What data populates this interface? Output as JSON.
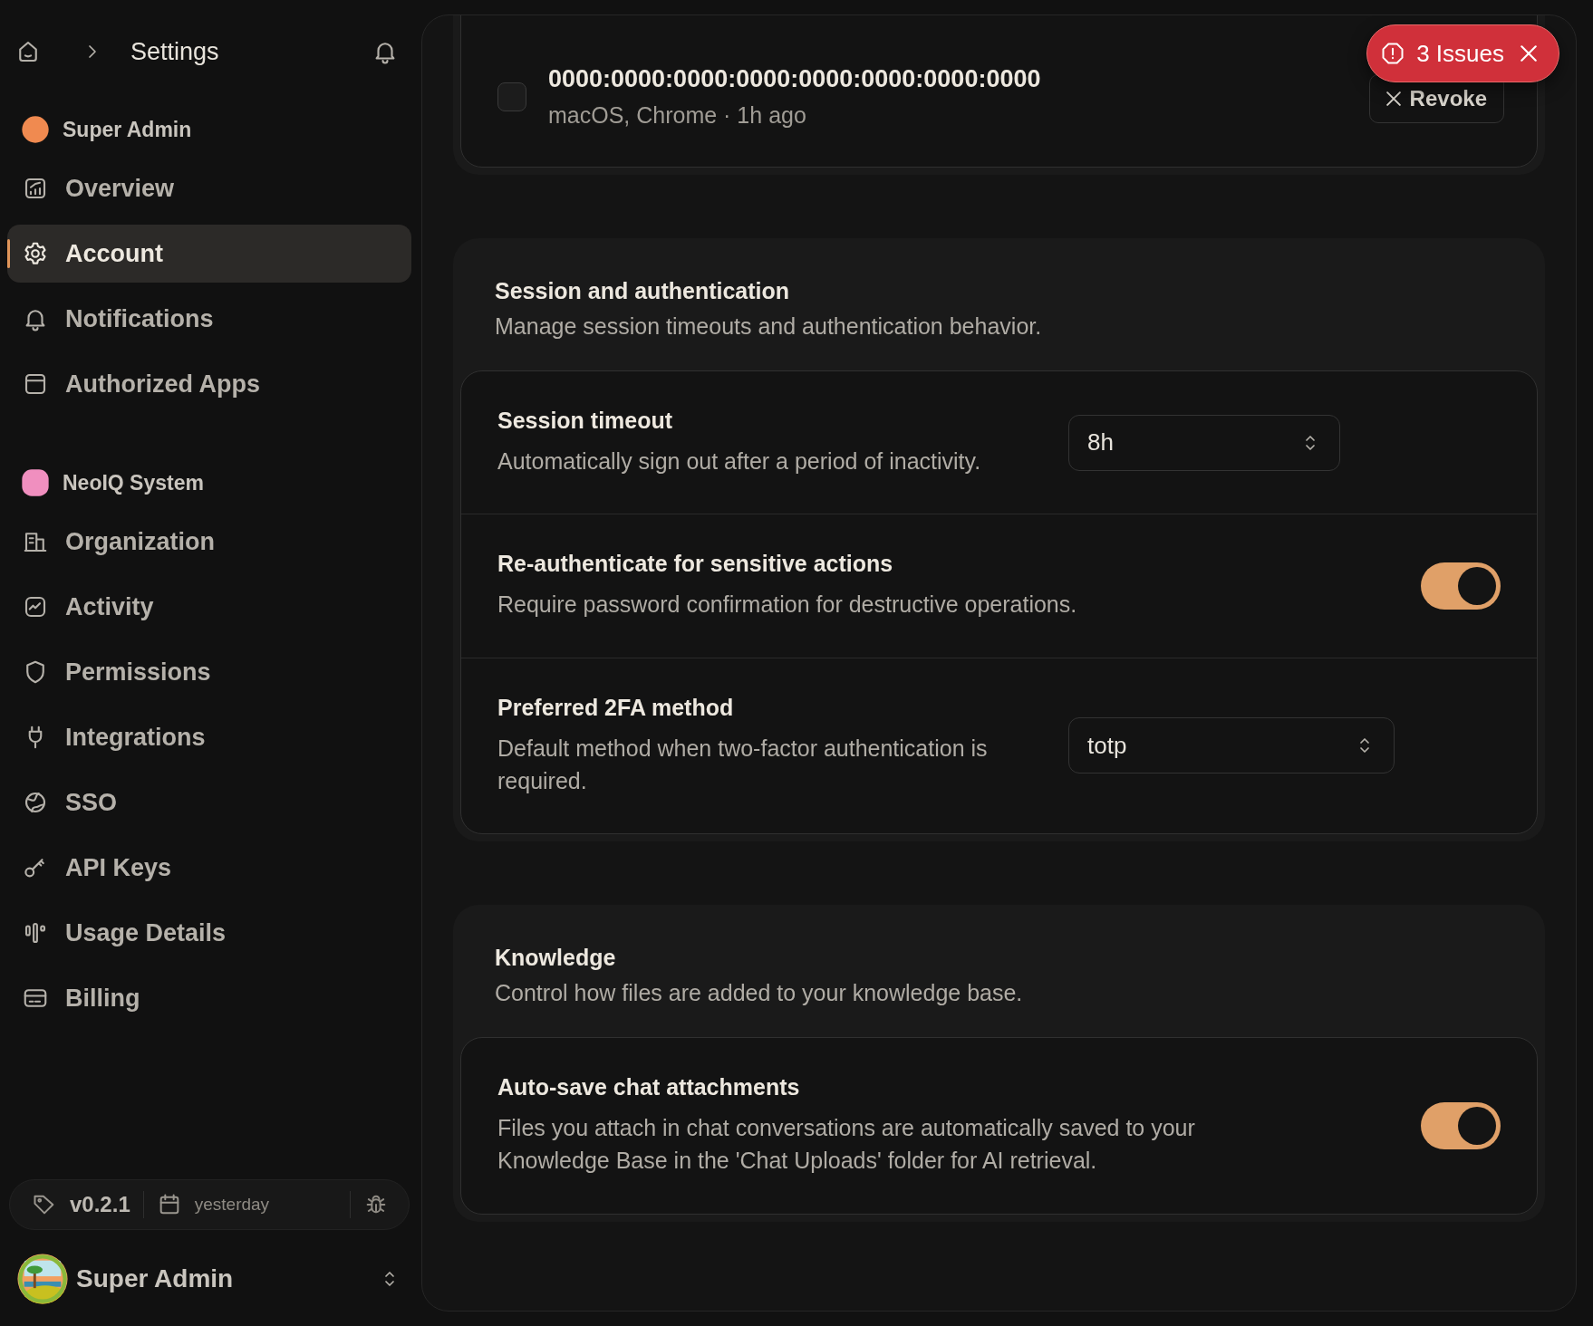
{
  "header": {
    "title": "Settings"
  },
  "sidebar": {
    "groups": [
      {
        "label": "Super Admin",
        "items": [
          {
            "label": "Overview",
            "selected": false
          },
          {
            "label": "Account",
            "selected": true
          },
          {
            "label": "Notifications",
            "selected": false
          },
          {
            "label": "Authorized Apps",
            "selected": false
          }
        ]
      },
      {
        "label": "NeoIQ System",
        "items": [
          {
            "label": "Organization",
            "selected": false
          },
          {
            "label": "Activity",
            "selected": false
          },
          {
            "label": "Permissions",
            "selected": false
          },
          {
            "label": "Integrations",
            "selected": false
          },
          {
            "label": "SSO",
            "selected": false
          },
          {
            "label": "API Keys",
            "selected": false
          },
          {
            "label": "Usage Details",
            "selected": false
          },
          {
            "label": "Billing",
            "selected": false
          }
        ]
      }
    ]
  },
  "footer": {
    "version": "v0.2.1",
    "date": "yesterday"
  },
  "user": {
    "name": "Super Admin"
  },
  "device": {
    "address": "0000:0000:0000:0000:0000:0000:0000:0000",
    "meta": "macOS, Chrome · 1h ago",
    "checked": false,
    "action": "Revoke"
  },
  "sections": [
    {
      "title": "Session and authentication",
      "description": "Manage session timeouts and authentication behavior.",
      "settings": [
        {
          "kind": "select",
          "title": "Session timeout",
          "description": "Automatically sign out after a period of inactivity.",
          "value": "8h"
        },
        {
          "kind": "toggle",
          "title": "Re-authenticate for sensitive actions",
          "description": "Require password confirmation for destructive operations.",
          "on": true
        },
        {
          "kind": "select",
          "title": "Preferred 2FA method",
          "description": "Default method when two-factor authentication is required.",
          "value": "totp"
        }
      ]
    },
    {
      "title": "Knowledge",
      "description": "Control how files are added to your knowledge base.",
      "settings": [
        {
          "kind": "toggle",
          "title": "Auto-save chat attachments",
          "description": "Files you attach in chat conversations are automatically saved to your Knowledge Base in the 'Chat Uploads' folder for AI retrieval.",
          "on": true
        }
      ]
    }
  ],
  "issues_badge": {
    "label": "3 Issues"
  }
}
